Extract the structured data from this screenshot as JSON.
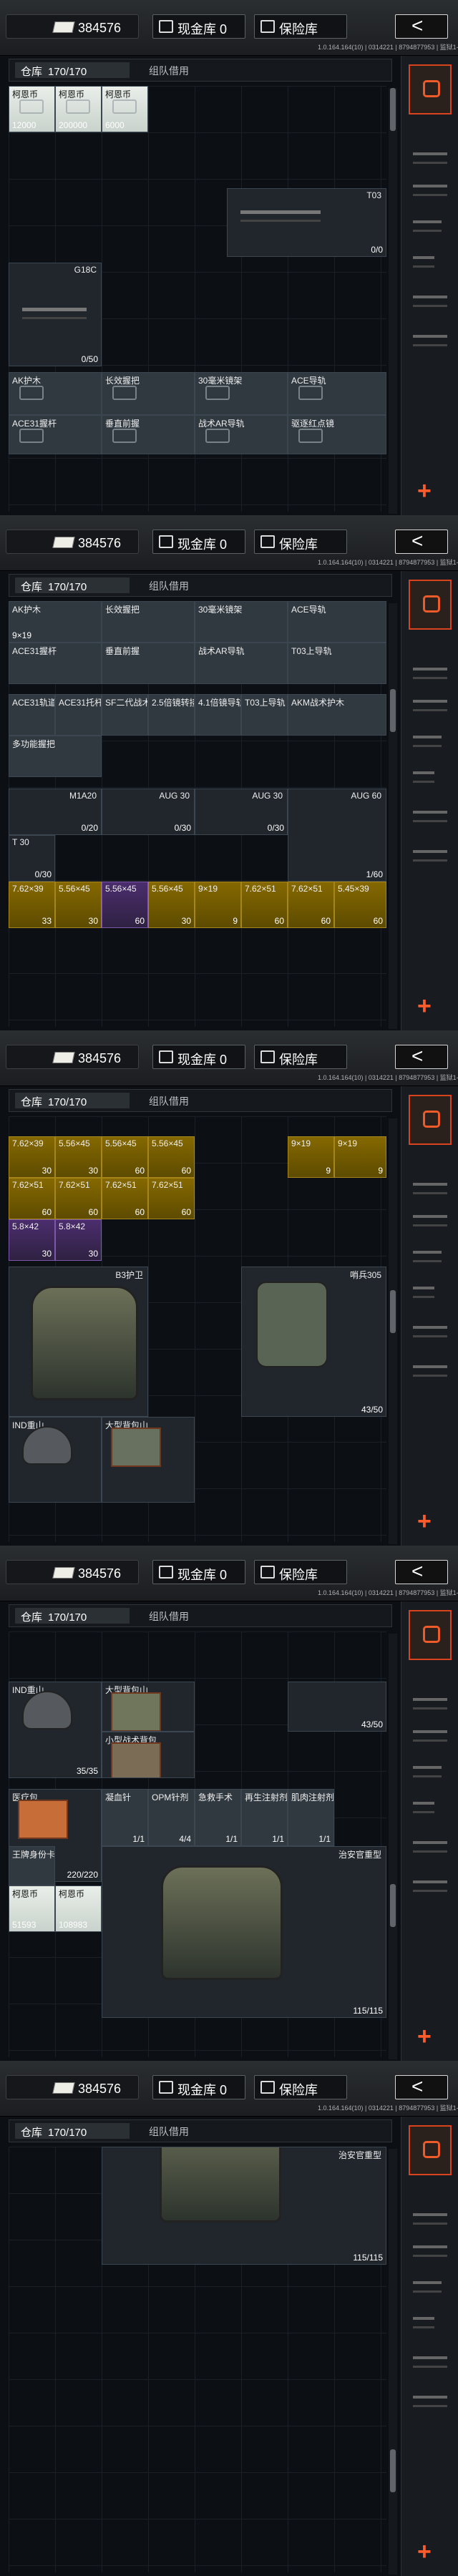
{
  "shared": {
    "cash_amount": "384576",
    "cash_vault_label": "现金库",
    "cash_vault_count": "0",
    "safe_label": "保险库",
    "back_label": "<",
    "server_text": "1.0.164.164(10) | 0314221 | 8794877953 | 监狱1-8",
    "storage_tab": "仓库",
    "storage_capacity": "170/170",
    "team_tab": "组队借用"
  },
  "panels": [
    {
      "items": [
        {
          "label": "柯恩币",
          "qty": "12000",
          "type": "money"
        },
        {
          "label": "柯恩币",
          "qty": "200000",
          "type": "money"
        },
        {
          "label": "柯恩币",
          "qty": "6000",
          "type": "money"
        },
        {
          "label": "T03",
          "qty": "0/0",
          "type": "weapon"
        },
        {
          "label": "G18C",
          "qty": "0/50",
          "type": "weapon"
        },
        {
          "label": "AK护木",
          "qty": "",
          "type": "gray"
        },
        {
          "label": "长效握把",
          "qty": "",
          "type": "gray"
        },
        {
          "label": "30毫米镜架",
          "qty": "",
          "type": "gray"
        },
        {
          "label": "ACE导轨",
          "qty": "",
          "type": "gray"
        },
        {
          "label": "ACE31握杆",
          "qty": "",
          "type": "gray"
        },
        {
          "label": "垂直前握",
          "qty": "",
          "type": "gray"
        },
        {
          "label": "战术AR导轨",
          "qty": "",
          "type": "gray"
        },
        {
          "label": "驱逐红点镜",
          "qty": "",
          "type": "gray"
        }
      ]
    },
    {
      "items": [
        {
          "label": "AK护木",
          "qty": "9×19",
          "type": "gray"
        },
        {
          "label": "长效握把",
          "qty": "",
          "type": "gray"
        },
        {
          "label": "30毫米镜架",
          "qty": "",
          "type": "gray"
        },
        {
          "label": "ACE导轨",
          "qty": "",
          "type": "gray"
        },
        {
          "label": "ACE31握杆",
          "qty": "",
          "type": "gray"
        },
        {
          "label": "垂直前握",
          "qty": "",
          "type": "gray"
        },
        {
          "label": "战术AR导轨",
          "qty": "",
          "type": "gray"
        },
        {
          "label": "T03上导轨",
          "qty": "",
          "type": "gray"
        },
        {
          "label": "ACE31轨道",
          "qty": "",
          "type": "gray"
        },
        {
          "label": "ACE31托杆",
          "qty": "",
          "type": "gray"
        },
        {
          "label": "SF二代战术握把",
          "qty": "",
          "type": "gray"
        },
        {
          "label": "2.5倍镜转接",
          "qty": "",
          "type": "gray"
        },
        {
          "label": "4.1倍镜导轨",
          "qty": "",
          "type": "gray"
        },
        {
          "label": "T03上导轨",
          "qty": "",
          "type": "gray"
        },
        {
          "label": "AKM战术护木",
          "qty": "",
          "type": "gray"
        },
        {
          "label": "多功能握把",
          "qty": "",
          "type": "gray"
        },
        {
          "label": "M1A20",
          "qty": "0/20",
          "type": "weapon"
        },
        {
          "label": "AUG 30",
          "qty": "0/30",
          "type": "weapon"
        },
        {
          "label": "AUG 30",
          "qty": "0/30",
          "type": "weapon"
        },
        {
          "label": "AUG 60",
          "qty": "1/60",
          "type": "weapon"
        },
        {
          "label": "T 30",
          "qty": "0/30",
          "type": "weapon"
        },
        {
          "label": "7.62×39",
          "qty": "33",
          "type": "gold"
        },
        {
          "label": "5.56×45",
          "qty": "30",
          "type": "gold"
        },
        {
          "label": "5.56×45",
          "qty": "60",
          "type": "purple"
        },
        {
          "label": "5.56×45",
          "qty": "30",
          "type": "gold"
        },
        {
          "label": "9×19",
          "qty": "9",
          "type": "gold"
        },
        {
          "label": "7.62×51",
          "qty": "60",
          "type": "gold"
        },
        {
          "label": "7.62×51",
          "qty": "60",
          "type": "gold"
        },
        {
          "label": "5.45×39",
          "qty": "60",
          "type": "gold"
        }
      ]
    },
    {
      "items": [
        {
          "label": "7.62×39",
          "qty": "30",
          "type": "gold"
        },
        {
          "label": "5.56×45",
          "qty": "30",
          "type": "gold"
        },
        {
          "label": "5.56×45",
          "qty": "60",
          "type": "gold"
        },
        {
          "label": "5.56×45",
          "qty": "60",
          "type": "gold"
        },
        {
          "label": "9×19",
          "qty": "9",
          "type": "gold"
        },
        {
          "label": "9×19",
          "qty": "9",
          "type": "gold"
        },
        {
          "label": "7.62×51",
          "qty": "60",
          "type": "gold"
        },
        {
          "label": "7.62×51",
          "qty": "60",
          "type": "gold"
        },
        {
          "label": "7.62×51",
          "qty": "60",
          "type": "gold"
        },
        {
          "label": "7.62×51",
          "qty": "60",
          "type": "gold"
        },
        {
          "label": "5.8×42",
          "qty": "30",
          "type": "purple"
        },
        {
          "label": "5.8×42",
          "qty": "30",
          "type": "purple"
        },
        {
          "label": "B3护卫",
          "qty": "",
          "type": "weapon"
        },
        {
          "label": "哨兵305",
          "qty": "43/50",
          "type": "weapon"
        },
        {
          "label": "IND重山",
          "qty": "",
          "type": "weapon"
        },
        {
          "label": "大型背包山",
          "qty": "",
          "type": "weapon"
        }
      ]
    },
    {
      "items": [
        {
          "label": "IND重山",
          "qty": "35/35",
          "type": "weapon"
        },
        {
          "label": "大型背包山",
          "qty": "43/50",
          "type": "weapon"
        },
        {
          "label": "小型战术背包",
          "qty": "",
          "type": "weapon"
        },
        {
          "label": "医疗包",
          "qty": "220/220",
          "type": "weapon"
        },
        {
          "label": "凝血针",
          "qty": "1/1",
          "type": "gray"
        },
        {
          "label": "OPM针剂",
          "qty": "4/4",
          "type": "gray"
        },
        {
          "label": "急救手术",
          "qty": "1/1",
          "type": "gray"
        },
        {
          "label": "再生注射剂",
          "qty": "1/1",
          "type": "gray"
        },
        {
          "label": "肌肉注射剂",
          "qty": "1/1",
          "type": "gray"
        },
        {
          "label": "王牌身份卡",
          "qty": "",
          "type": "gray"
        },
        {
          "label": "柯恩币",
          "qty": "51593",
          "type": "money"
        },
        {
          "label": "柯恩币",
          "qty": "108983",
          "type": "money"
        },
        {
          "label": "治安官重型",
          "qty": "115/115",
          "type": "weapon"
        }
      ]
    },
    {
      "items": [
        {
          "label": "治安官重型",
          "qty": "115/115",
          "type": "weapon"
        }
      ]
    }
  ]
}
